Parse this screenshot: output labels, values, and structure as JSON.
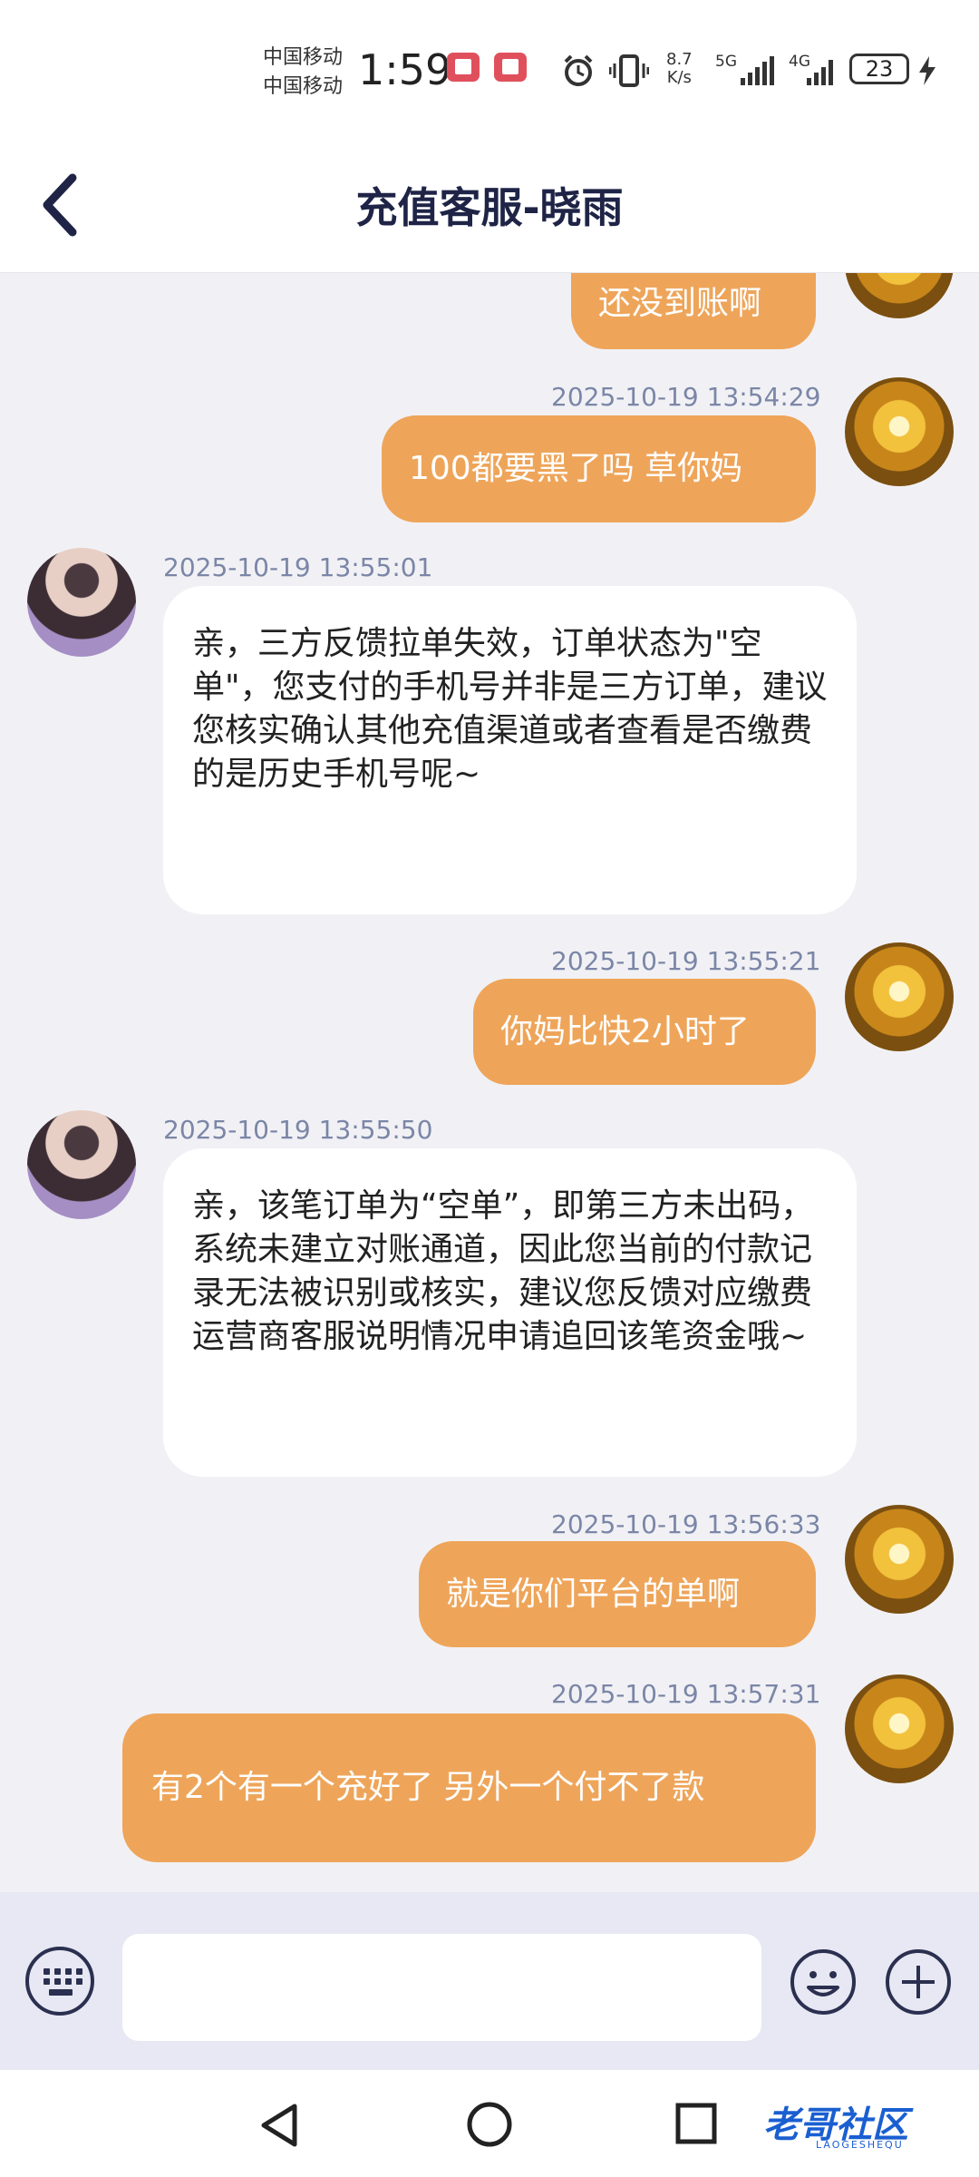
{
  "status_bar": {
    "carrier_1": "中国移动",
    "carrier_2": "中国移动",
    "time": "1:59",
    "speed_value": "8.7",
    "speed_unit": "K/s",
    "net_1": "5G",
    "net_2": "4G",
    "battery": "23"
  },
  "header": {
    "title": "充值客服-晓雨"
  },
  "messages": [
    {
      "side": "right",
      "text": "还没到账啊"
    },
    {
      "side": "right",
      "time": "2025-10-19 13:54:29",
      "text": "100都要黑了吗 草你妈"
    },
    {
      "side": "left",
      "time": "2025-10-19 13:55:01",
      "text": "亲，三方反馈拉单失效，订单状态为\"空单\"，您支付的手机号并非是三方订单，建议您核实确认其他充值渠道或者查看是否缴费的是历史手机号呢~"
    },
    {
      "side": "right",
      "time": "2025-10-19 13:55:21",
      "text": "你妈比快2小时了"
    },
    {
      "side": "left",
      "time": "2025-10-19 13:55:50",
      "text": "亲，该笔订单为“空单”，即第三方未出码，系统未建立对账通道，因此您当前的付款记录无法被识别或核实，建议您反馈对应缴费运营商客服说明情况申请追回该笔资金哦~"
    },
    {
      "side": "right",
      "time": "2025-10-19 13:56:33",
      "text": "就是你们平台的单啊"
    },
    {
      "side": "right",
      "time": "2025-10-19 13:57:31",
      "text": "有2个有一个充好了 另外一个付不了款"
    }
  ],
  "input": {
    "placeholder": ""
  },
  "watermark": {
    "main": "老哥社区",
    "sub": "LAOGESHEQU"
  },
  "colors": {
    "bubble_out": "#eea55a",
    "bubble_in": "#ffffff",
    "timestamp": "#7b86a7",
    "title": "#1f2447"
  },
  "icons": [
    "back-icon",
    "keyboard-icon",
    "emoji-icon",
    "plus-icon",
    "nav-back-icon",
    "nav-home-icon",
    "nav-recents-icon"
  ]
}
